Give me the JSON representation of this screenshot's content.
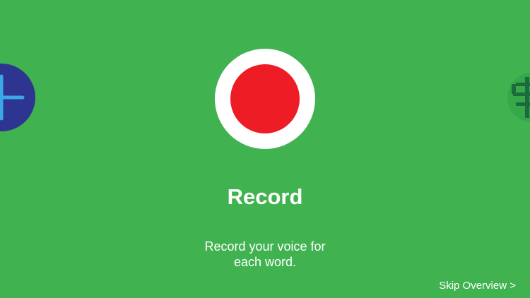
{
  "colors": {
    "background": "#40b350",
    "record_outer": "#ffffff",
    "record_inner": "#ee1c25",
    "prev_icon_bg": "#2e3590",
    "prev_icon_stroke": "#3aa8e6",
    "next_icon_bg": "#36a84a",
    "next_icon_glyph": "#1a6d3a",
    "text": "#ffffff"
  },
  "icons": {
    "prev": "plus-icon",
    "record": "record-icon",
    "next": "tree-icon"
  },
  "slide": {
    "title": "Record",
    "description_line1": "Record your voice for",
    "description_line2": "each word."
  },
  "footer": {
    "skip_label": "Skip Overview >"
  }
}
